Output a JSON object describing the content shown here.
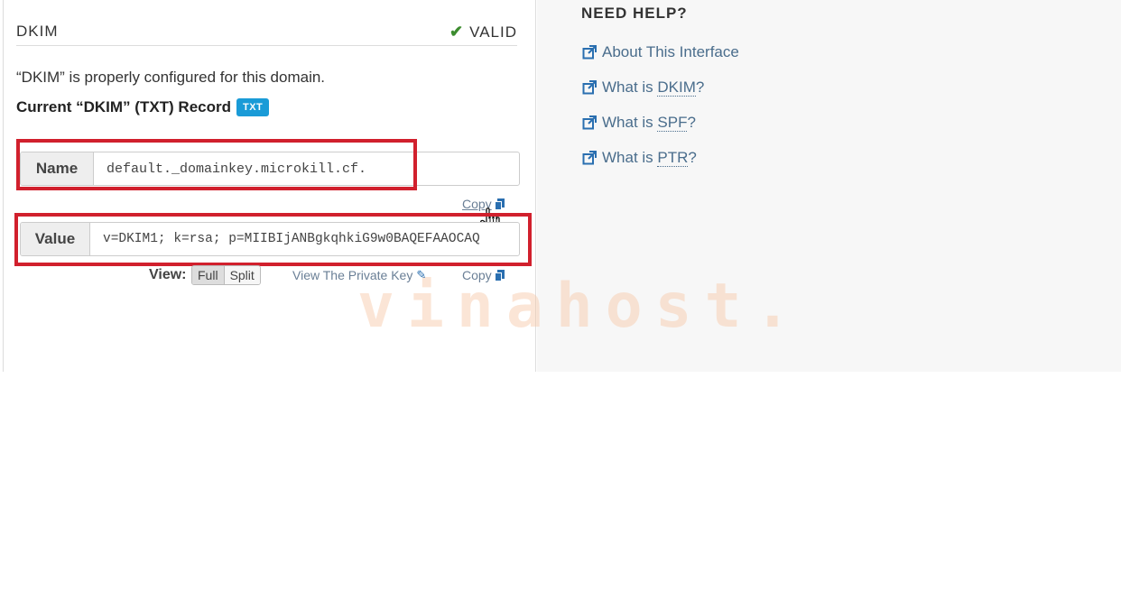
{
  "dkim": {
    "title": "DKIM",
    "status": "VALID",
    "description": "“DKIM” is properly configured for this domain.",
    "record_label": "Current “DKIM” (TXT) Record",
    "badge": "TXT",
    "name_label": "Name",
    "name_value": "default._domainkey.microkill.cf.",
    "value_label": "Value",
    "value_value": "v=DKIM1; k=rsa; p=MIIBIjANBgkqhkiG9w0BAQEFAAOCAQ",
    "copy_label": "Copy",
    "view_label": "View:",
    "view_full": "Full",
    "view_split": "Split",
    "private_key_link": "View The Private Key"
  },
  "help": {
    "title": "NEED HELP?",
    "links": [
      {
        "prefix": "About This Interface",
        "abbr": "",
        "suffix": ""
      },
      {
        "prefix": "What is ",
        "abbr": "DKIM",
        "suffix": "?"
      },
      {
        "prefix": "What is ",
        "abbr": "SPF",
        "suffix": "?"
      },
      {
        "prefix": "What is ",
        "abbr": "PTR",
        "suffix": "?"
      }
    ]
  },
  "watermark": "vinahost.",
  "colors": {
    "highlight": "#d1202d",
    "badge": "#1a9bd7",
    "valid": "#3c8c2f",
    "link": "#4a6d8c"
  },
  "icons": [
    "check-icon",
    "copy-icon",
    "pencil-icon",
    "external-link-icon",
    "hand-cursor-icon"
  ]
}
